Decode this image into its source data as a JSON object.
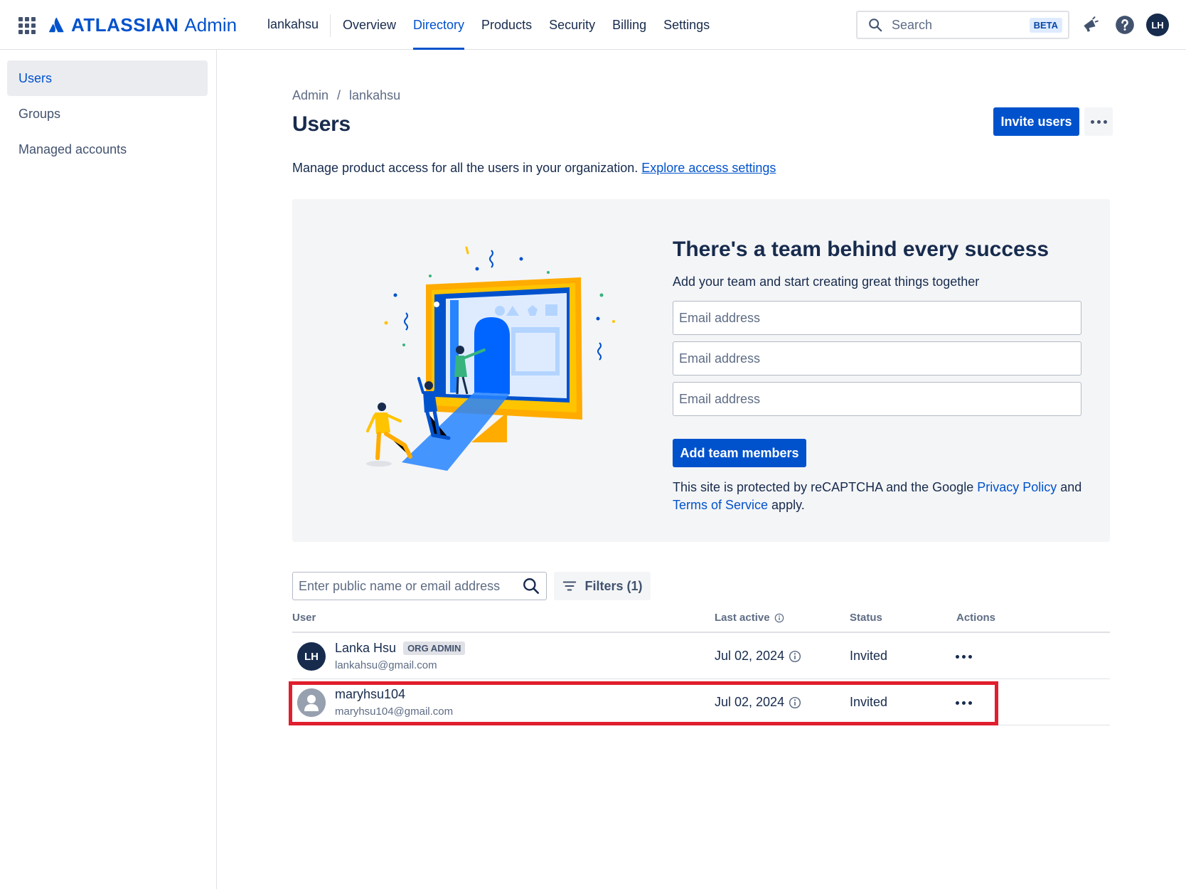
{
  "header": {
    "brand": "ATLASSIAN",
    "product": "Admin",
    "org": "lankahsu",
    "nav": [
      {
        "label": "Overview"
      },
      {
        "label": "Directory"
      },
      {
        "label": "Products"
      },
      {
        "label": "Security"
      },
      {
        "label": "Billing"
      },
      {
        "label": "Settings"
      }
    ],
    "active_nav": "Directory",
    "search_placeholder": "Search",
    "search_badge": "BETA",
    "avatar_initials": "LH"
  },
  "sidebar": {
    "items": [
      {
        "label": "Users"
      },
      {
        "label": "Groups"
      },
      {
        "label": "Managed accounts"
      }
    ],
    "active": "Users"
  },
  "main": {
    "breadcrumb": {
      "root": "Admin",
      "sep": "/",
      "org": "lankahsu"
    },
    "title": "Users",
    "invite_label": "Invite users",
    "description": "Manage product access for all the users in your organization.",
    "description_link": "Explore access settings"
  },
  "promo": {
    "title": "There's a team behind every success",
    "subtitle": "Add your team and start creating great things together",
    "email_placeholder": "Email address",
    "add_button": "Add team members",
    "recaptcha_pre": "This site is protected by reCAPTCHA and the Google ",
    "privacy_link": "Privacy Policy",
    "recaptcha_mid": " and",
    "terms_link": "Terms of Service",
    "recaptcha_post": " apply."
  },
  "users_table": {
    "search_placeholder": "Enter public name or email address",
    "filters_label": "Filters (1)",
    "columns": {
      "user": "User",
      "last_active": "Last active",
      "status": "Status",
      "actions": "Actions"
    },
    "rows": [
      {
        "initials": "LH",
        "name": "Lanka Hsu",
        "badge": "ORG ADMIN",
        "email": "lankahsu@gmail.com",
        "last_active": "Jul 02, 2024",
        "status": "Invited"
      },
      {
        "initials": "",
        "name": "maryhsu104",
        "badge": "",
        "email": "maryhsu104@gmail.com",
        "last_active": "Jul 02, 2024",
        "status": "Invited"
      }
    ]
  },
  "colors": {
    "brand": "#0052cc",
    "highlight": "#e01e2d",
    "text": "#172b4d"
  }
}
